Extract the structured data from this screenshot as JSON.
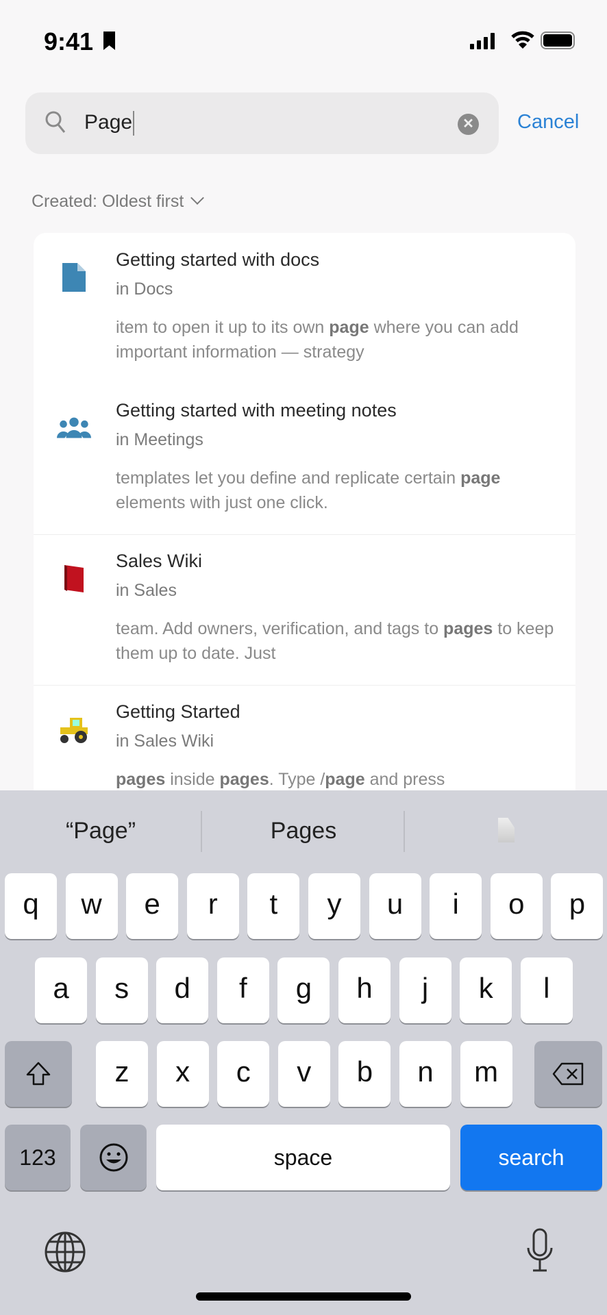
{
  "status": {
    "time": "9:41"
  },
  "search": {
    "value": "Page",
    "cancel": "Cancel"
  },
  "sort": {
    "label": "Created: Oldest first"
  },
  "results": [
    {
      "title": "Getting started with docs",
      "location": "in Docs",
      "icon": "document-icon",
      "snippet": [
        [
          "item to open it up to its own ",
          false
        ],
        [
          "page",
          true
        ],
        [
          " where you can add important information — strategy",
          false
        ]
      ]
    },
    {
      "title": "Getting started with meeting notes",
      "location": "in Meetings",
      "icon": "people-icon",
      "snippet": [
        [
          "templates let you define and replicate certain ",
          false
        ],
        [
          "page",
          true
        ],
        [
          " elements with just one click.",
          false
        ]
      ]
    },
    {
      "title": "Sales Wiki",
      "location": "in Sales",
      "icon": "red-book-icon",
      "snippet": [
        [
          "team. Add owners, verification, and tags to ",
          false
        ],
        [
          "pages",
          true
        ],
        [
          " to keep them up to date. Just",
          false
        ]
      ]
    },
    {
      "title": "Getting Started",
      "location": "in Sales Wiki",
      "icon": "tractor-icon",
      "snippet": [
        [
          "pages",
          true
        ],
        [
          " inside ",
          false
        ],
        [
          "pages",
          true
        ],
        [
          ". Type /",
          false
        ],
        [
          "page",
          true
        ],
        [
          " and press",
          false
        ]
      ]
    }
  ],
  "keyboard": {
    "suggestions": [
      "“Page”",
      "Pages"
    ],
    "row1": [
      "q",
      "w",
      "e",
      "r",
      "t",
      "y",
      "u",
      "i",
      "o",
      "p"
    ],
    "row2": [
      "a",
      "s",
      "d",
      "f",
      "g",
      "h",
      "j",
      "k",
      "l"
    ],
    "row3": [
      "z",
      "x",
      "c",
      "v",
      "b",
      "n",
      "m"
    ],
    "numbers": "123",
    "space": "space",
    "search": "search"
  },
  "colors": {
    "accent": "#2b82d5",
    "search_key": "#1277f0",
    "doc_icon": "#3d86b4"
  }
}
